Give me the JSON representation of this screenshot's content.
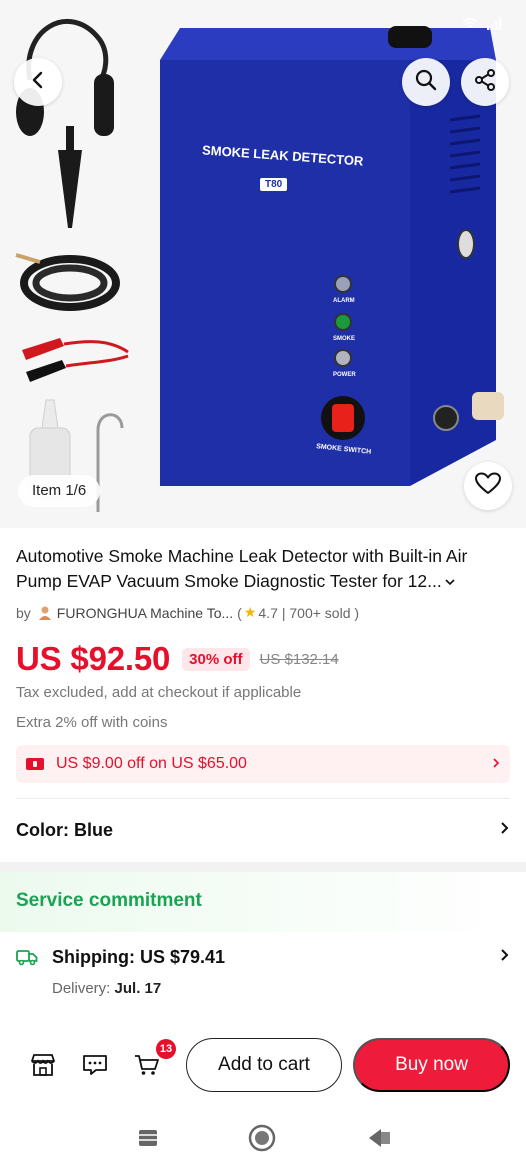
{
  "hero": {
    "device_label": "SMOKE LEAK DETECTOR",
    "device_model": "T80",
    "indicator_labels": [
      "ALARM",
      "SMOKE",
      "POWER"
    ],
    "switch_label": "SMOKE SWITCH",
    "item_counter": "Item 1/6"
  },
  "product": {
    "title": "Automotive Smoke Machine Leak Detector with Built-in Air Pump EVAP Vacuum Smoke Diagnostic Tester for 12...",
    "store_prefix": "by",
    "store_name": "FURONGHUA Machine To...",
    "rating_prefix": "(",
    "rating": "4.7",
    "sold": "| 700+ sold )",
    "price": "US $92.50",
    "discount": "30% off",
    "original_price": "US $132.14",
    "tax_note": "Tax excluded, add at checkout if applicable",
    "coins_note": "Extra 2% off with coins",
    "coupon": "US $9.00 off on US $65.00",
    "color_label": "Color: Blue"
  },
  "service": {
    "title": "Service commitment",
    "shipping": "Shipping: US $79.41",
    "delivery_label": "Delivery:",
    "delivery_date": "Jul. 17"
  },
  "action_bar": {
    "cart_count": "13",
    "add_to_cart": "Add to cart",
    "buy_now": "Buy now"
  },
  "colors": {
    "accent": "#e4102c",
    "buy_button": "#ee1b3a",
    "service_green": "#1aa352",
    "device_blue": "#1e2fa8"
  }
}
